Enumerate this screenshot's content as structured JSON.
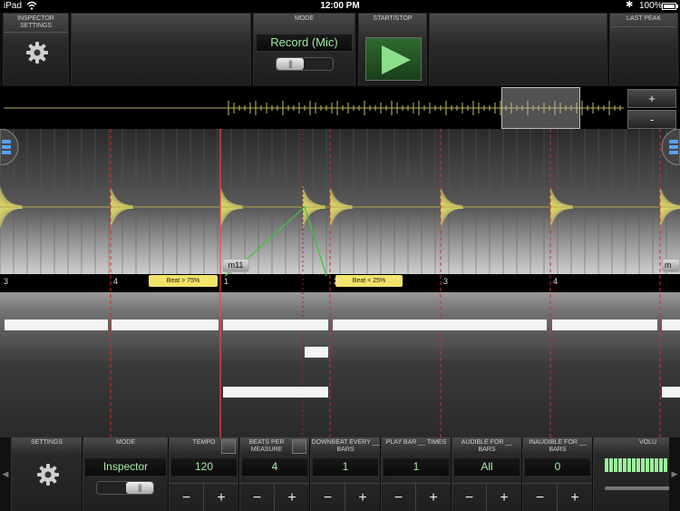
{
  "status": {
    "carrier": "iPad",
    "time": "12:00 PM",
    "battery": "100%"
  },
  "top": {
    "inspector_settings_label": "INSPECTOR SETTINGS",
    "mode_label": "MODE",
    "mode_value": "Record (Mic)",
    "start_stop_label": "START/STOP",
    "last_peak_label": "LAST PEAK"
  },
  "overview": {
    "zoom_in": "+",
    "zoom_out": "-"
  },
  "main": {
    "marker_tag": "m11",
    "marker_tag_right": "m",
    "beat_late": "Beat > 75%",
    "beat_early": "Beat < 25%",
    "beat_numbers": [
      "3",
      "4",
      "1",
      "2",
      "3",
      "4"
    ]
  },
  "bottom": {
    "settings_label": "SETTINGS",
    "mode_label": "MODE",
    "mode_value": "Inspector",
    "tempo_label": "TEMPO",
    "tempo_value": "120",
    "beats_label": "BEATS PER MEASURE",
    "beats_value": "4",
    "downbeat_label": "DOWNBEAT EVERY __ BARS",
    "downbeat_value": "1",
    "playbar_label": "PLAY BAR __ TIMES",
    "playbar_value": "1",
    "audible_label": "AUDIBLE FOR __ BARS",
    "audible_value": "All",
    "inaudible_label": "INAUDIBLE FOR __ BARS",
    "inaudible_value": "0",
    "volume_label": "VOLU",
    "minus": "−",
    "plus": "+"
  },
  "colors": {
    "accent_green": "#9ee89e",
    "beat_tag": "#f2e36a",
    "waveform": "#c8c060",
    "grid_red": "#d03030"
  }
}
